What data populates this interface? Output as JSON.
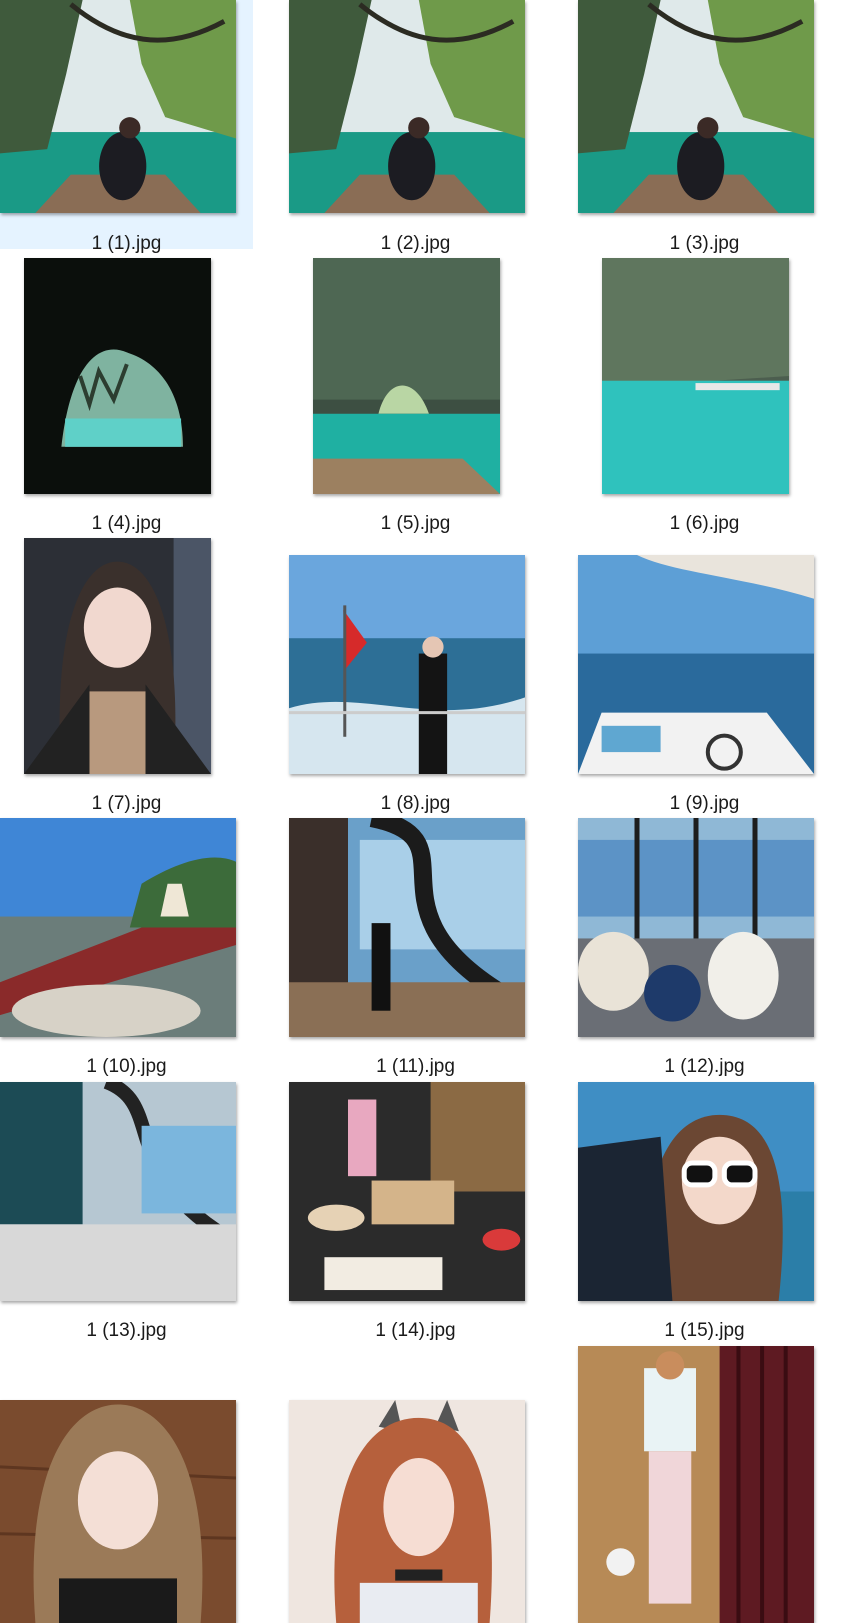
{
  "explorer": {
    "selected_index": 0,
    "files": [
      {
        "name": "1 (1).jpg",
        "icon": "photo-thumbnail-icon",
        "scene": "boat-cave-lake-woman"
      },
      {
        "name": "1 (2).jpg",
        "icon": "photo-thumbnail-icon",
        "scene": "boat-cave-lake-woman"
      },
      {
        "name": "1 (3).jpg",
        "icon": "photo-thumbnail-icon",
        "scene": "boat-cave-lake-woman"
      },
      {
        "name": "1 (4).jpg",
        "icon": "photo-thumbnail-icon",
        "scene": "dark-cave-opening"
      },
      {
        "name": "1 (5).jpg",
        "icon": "photo-thumbnail-icon",
        "scene": "cave-arch-boat-deck"
      },
      {
        "name": "1 (6).jpg",
        "icon": "photo-thumbnail-icon",
        "scene": "cave-cliff-turquoise-water"
      },
      {
        "name": "1 (7).jpg",
        "icon": "photo-thumbnail-icon",
        "scene": "selfie-portrait-indoor"
      },
      {
        "name": "1 (8).jpg",
        "icon": "photo-thumbnail-icon",
        "scene": "woman-on-boat-stern-flag"
      },
      {
        "name": "1 (9).jpg",
        "icon": "photo-thumbnail-icon",
        "scene": "yacht-deck-sea-view"
      },
      {
        "name": "1 (10).jpg",
        "icon": "photo-thumbnail-icon",
        "scene": "resort-terrace-lounge"
      },
      {
        "name": "1 (11).jpg",
        "icon": "photo-thumbnail-icon",
        "scene": "lobby-spiral-staircase"
      },
      {
        "name": "1 (12).jpg",
        "icon": "photo-thumbnail-icon",
        "scene": "lounge-chairs-ocean-windows"
      },
      {
        "name": "1 (13).jpg",
        "icon": "photo-thumbnail-icon",
        "scene": "lobby-glass-interior"
      },
      {
        "name": "1 (14).jpg",
        "icon": "photo-thumbnail-icon",
        "scene": "dessert-buffet"
      },
      {
        "name": "1 (15).jpg",
        "icon": "photo-thumbnail-icon",
        "scene": "sunglasses-selfie-sea"
      },
      {
        "name": "",
        "icon": "photo-thumbnail-icon",
        "scene": "selfie-wood-background"
      },
      {
        "name": "",
        "icon": "photo-thumbnail-icon",
        "scene": "selfie-cat-ears-filter"
      },
      {
        "name": "",
        "icon": "photo-thumbnail-icon",
        "scene": "mirror-selfie-curtain-room"
      }
    ]
  }
}
